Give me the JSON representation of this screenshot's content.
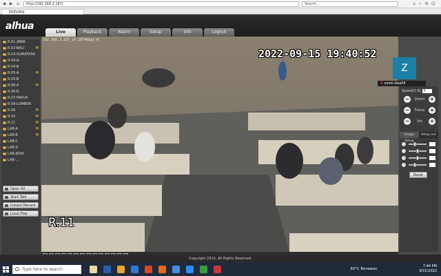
{
  "browser": {
    "url": "http://192.168.2.167/",
    "search_placeholder": "Search...",
    "tab_title": "PREVIEW"
  },
  "app": {
    "logo": "alhua",
    "menu": [
      {
        "label": "Live",
        "active": true
      },
      {
        "label": "Playback"
      },
      {
        "label": "Alarm"
      },
      {
        "label": "Setup"
      },
      {
        "label": "Info"
      },
      {
        "label": "Logout"
      }
    ],
    "footer": "Copyright 2015, All Rights Reserved."
  },
  "cameras": [
    {
      "label": "R.01-JAWA",
      "m": ""
    },
    {
      "label": "R.02-BALI",
      "m": "M"
    },
    {
      "label": "R.03-SUMATERA",
      "m": ""
    },
    {
      "label": "R.04-A",
      "m": ""
    },
    {
      "label": "R.04-B",
      "m": ""
    },
    {
      "label": "R.05-A",
      "m": "M"
    },
    {
      "label": "R.05-B",
      "m": ""
    },
    {
      "label": "R.06-A",
      "m": "M"
    },
    {
      "label": "R.06-B",
      "m": ""
    },
    {
      "label": "R.07-PAPUA",
      "m": ""
    },
    {
      "label": "R.08-LOMBOK",
      "m": ""
    },
    {
      "label": "R.09",
      "m": "M"
    },
    {
      "label": "R.10",
      "m": "M"
    },
    {
      "label": "R.11",
      "m": "M"
    },
    {
      "label": "LAB-A",
      "m": "M"
    },
    {
      "label": "LAB-B",
      "m": "M"
    },
    {
      "label": "LAB-C",
      "m": ""
    },
    {
      "label": "LAB-D",
      "m": ""
    },
    {
      "label": "LAB-JRSN",
      "m": ""
    },
    {
      "label": "LAB-...",
      "m": ""
    }
  ],
  "left_buttons": {
    "open_all": "Open All",
    "start_talk": "Start Talk",
    "instant_record": "Instant Record",
    "local_play": "Local Play"
  },
  "video": {
    "channel_label": "192.168.2.167_1A_1874kbps_R",
    "osd_time": "2022-09-15 19:40:52",
    "osd_name": "R.11"
  },
  "zoom": {
    "initial": "Z",
    "caption": "zoom.baa04"
  },
  "ptz": {
    "speed_label": "Speed(1-8)",
    "speed_value": "5",
    "zoom": "Zoom",
    "focus": "Focus",
    "iris": "Iris",
    "minus": "−",
    "plus": "+"
  },
  "image_setup": {
    "tab1": "Image Setup",
    "tab2": "Relay-out",
    "reset": "Reset",
    "sliders": [
      0.3,
      0.5,
      0.5,
      0.3
    ]
  },
  "taskbar": {
    "search": "Type here to search",
    "weather": "30°C  Berawan",
    "time": "7:44 PM",
    "date": "9/15/2022"
  }
}
